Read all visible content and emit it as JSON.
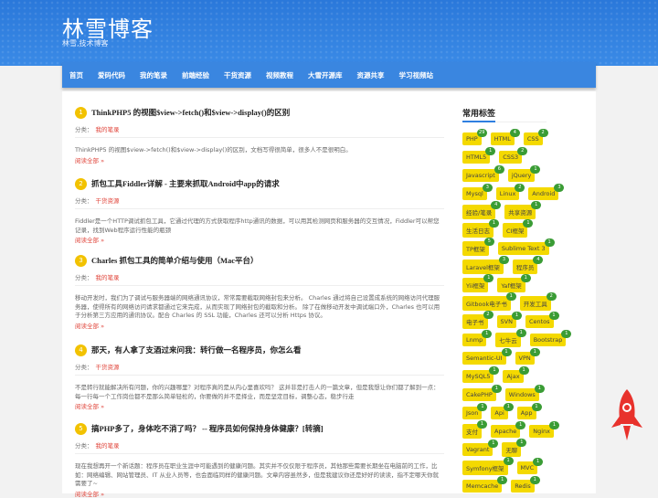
{
  "site": {
    "title": "林雪博客",
    "subtitle": "林雪,技术博客"
  },
  "nav": {
    "items": [
      {
        "label": "首页"
      },
      {
        "label": "爱码代码"
      },
      {
        "label": "我的笔录"
      },
      {
        "label": "前端经验"
      },
      {
        "label": "干货资源"
      },
      {
        "label": "视频教程"
      },
      {
        "label": "大雪开源库"
      },
      {
        "label": "资源共享"
      },
      {
        "label": "学习视频站"
      }
    ]
  },
  "posts": [
    {
      "num": "1",
      "title": "ThinkPHP5 的视图$view->fetch()和$view->display()的区别",
      "meta_label": "分类：",
      "category": "我的笔录",
      "excerpt": "ThinkPHP5 的视图$view->fetch()和$view->display()的区别，文档写得很简单，很多人不是很明白。",
      "more": "阅读全部 »"
    },
    {
      "num": "2",
      "title": "抓包工具Fiddler详解 - 主要来抓取Android中app的请求",
      "meta_label": "分类：",
      "category": "干货资源",
      "excerpt": "Fiddler是一个HTTP调试抓包工具，它通过代理的方式获取程序http通讯的数据，可以用其检测网页和服务器的交互情况，Fiddler可以帮您记录，找到Web程序运行性能的瓶颈",
      "more": "阅读全部 »"
    },
    {
      "num": "3",
      "title": "Charles 抓包工具的简单介绍与使用（Mac平台）",
      "meta_label": "分类：",
      "category": "我的笔录",
      "excerpt": "移动开发时，我们为了调试与服务器端的网络通讯协议，常常需要截取网络封包来分析。 Charles 通过将自己设置成系统的网络访问代理服务器，使得所有的网络访问请求都通过它来完成，从而实现了网络封包的截取和分析。 除了在做移动开发中调试端口外，Charles 也可以用于分析第三方应用的通讯协议。配合 Charles 的 SSL 功能，Charles 还可以分析 Https 协议。",
      "more": "阅读全部 »"
    },
    {
      "num": "4",
      "title": "那天，有人拿了支酒过来问我：转行做一名程序员，你怎么看",
      "meta_label": "分类：",
      "category": "干货资源",
      "excerpt": "不是转行就能解决所有问题，你的兴趣哪里？对程序真的是从内心里喜欢吗？ 这并非是打击人的一篇文章，但是我想让你们都了解到一点：每一行每一个工作岗位都不是那么简单轻松的，你要做的并不是择业，而是坚定目标，调整心态，稳步行走",
      "more": "阅读全部 »"
    },
    {
      "num": "5",
      "title": "搞PHP多了，身体吃不消了吗？ -- 程序员如何保持身体健康？[转摘]",
      "meta_label": "分类：",
      "category": "我的笔录",
      "excerpt": "现在我想再开一个新话题：程序员在职业生涯中可能遇到的健康问题。其实并不仅仅限于程序员，其他那些需要长期坐在电脑前的工作，比如：网络编辑、网站管理员、IT 从业人员等，也会面临同样的健康问题。文章内容虽然多，但是我建议你还是好好的读读，指不定哪天你就需要了~",
      "more": "阅读全部 »"
    }
  ],
  "sidebar": {
    "title": "常用标签",
    "tag_rows": [
      [
        {
          "label": "PHP",
          "count": "29"
        },
        {
          "label": "HTML",
          "count": "4"
        },
        {
          "label": "CSS",
          "count": "2"
        }
      ],
      [
        {
          "label": "HTML5",
          "count": "1"
        },
        {
          "label": "CSS3",
          "count": "2"
        }
      ],
      [
        {
          "label": "Javascript",
          "count": "6"
        },
        {
          "label": "jQuery",
          "count": "1"
        }
      ],
      [
        {
          "label": "Mysql",
          "count": "3"
        },
        {
          "label": "Linux",
          "count": "2"
        },
        {
          "label": "Android",
          "count": "3"
        }
      ],
      [
        {
          "label": "经验/笔录",
          "count": "4"
        },
        {
          "label": "共享资源",
          "count": "1"
        }
      ],
      [
        {
          "label": "生活日志",
          "count": "1"
        },
        {
          "label": "CI框架",
          "count": "1"
        }
      ],
      [
        {
          "label": "TP框架",
          "count": "5"
        },
        {
          "label": "Sublime Text 3",
          "count": "1"
        }
      ],
      [
        {
          "label": "Laravel框架",
          "count": "3"
        },
        {
          "label": "程序员",
          "count": "4"
        }
      ],
      [
        {
          "label": "Yii框架",
          "count": "1"
        },
        {
          "label": "Yaf框架",
          "count": "1"
        }
      ],
      [
        {
          "label": "Gitbook电子书",
          "count": "1"
        },
        {
          "label": "开发工具",
          "count": "2"
        }
      ],
      [
        {
          "label": "电子书",
          "count": "2"
        },
        {
          "label": "SVN",
          "count": "1"
        },
        {
          "label": "Centos",
          "count": "1"
        }
      ],
      [
        {
          "label": "Lnmp",
          "count": "1"
        },
        {
          "label": "七牛云",
          "count": "1"
        },
        {
          "label": "Bootstrap",
          "count": "1"
        }
      ],
      [
        {
          "label": "Semantic-UI",
          "count": "1"
        },
        {
          "label": "VPN",
          "count": "1"
        }
      ],
      [
        {
          "label": "MySQL5",
          "count": "1"
        },
        {
          "label": "Ajax",
          "count": "1"
        }
      ],
      [
        {
          "label": "CakePHP",
          "count": "1"
        },
        {
          "label": "Windows",
          "count": "1"
        }
      ],
      [
        {
          "label": "Json",
          "count": "1"
        },
        {
          "label": "Api",
          "count": "1"
        },
        {
          "label": "App",
          "count": "1"
        }
      ],
      [
        {
          "label": "支付",
          "count": "1"
        },
        {
          "label": "Apache",
          "count": "1"
        },
        {
          "label": "Nginx",
          "count": "1"
        }
      ],
      [
        {
          "label": "Vagrant",
          "count": "1"
        },
        {
          "label": "无聊",
          "count": "1"
        }
      ],
      [
        {
          "label": "Symfony框架",
          "count": "1"
        },
        {
          "label": "MVC",
          "count": "1"
        }
      ],
      [
        {
          "label": "Memcache",
          "count": "1"
        },
        {
          "label": "Redis",
          "count": "1"
        }
      ]
    ]
  },
  "colors": {
    "brand": "#2f7fe0",
    "tag": "#f4d900",
    "badge": "#3a9c35",
    "link": "#e0443a",
    "rocket": "#e8322c"
  },
  "icons": {
    "back_to_top": "rocket-icon"
  }
}
